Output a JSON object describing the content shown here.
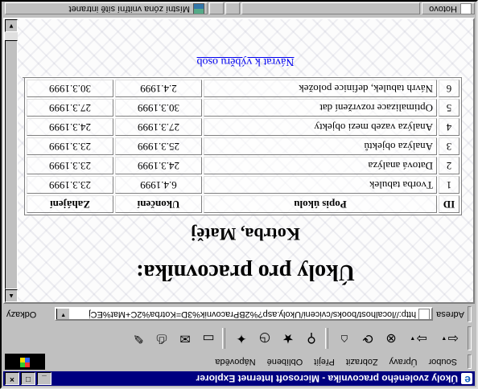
{
  "window": {
    "title": "Úkoly zvoleného pracovníka - Microsoft Internet Explorer",
    "buttons": {
      "minimize": "_",
      "maximize": "□",
      "close": "×"
    }
  },
  "menu": {
    "items": [
      "Soubor",
      "Úpravy",
      "Zobrazit",
      "Přejít",
      "Oblíbené",
      "Nápověda"
    ]
  },
  "toolbar": {
    "buttons": [
      {
        "name": "back-button",
        "icon": "arrow-left-icon",
        "glyph": "⇦"
      },
      {
        "name": "forward-button",
        "icon": "arrow-right-icon",
        "glyph": "⇨"
      },
      {
        "name": "stop-button",
        "icon": "stop-icon",
        "glyph": "⊗"
      },
      {
        "name": "refresh-button",
        "icon": "refresh-icon",
        "glyph": "⟳"
      },
      {
        "name": "home-button",
        "icon": "home-icon",
        "glyph": "⌂"
      },
      {
        "name": "search-button",
        "icon": "search-icon",
        "glyph": "⚲"
      },
      {
        "name": "favorites-button",
        "icon": "favorites-icon",
        "glyph": "★"
      },
      {
        "name": "history-button",
        "icon": "history-icon",
        "glyph": "◷"
      },
      {
        "name": "channels-button",
        "icon": "channels-icon",
        "glyph": "✦"
      },
      {
        "name": "fullscreen-button",
        "icon": "fullscreen-icon",
        "glyph": "▭"
      },
      {
        "name": "mail-button",
        "icon": "mail-icon",
        "glyph": "✉"
      },
      {
        "name": "print-button",
        "icon": "print-icon",
        "glyph": "⎙"
      },
      {
        "name": "edit-button",
        "icon": "edit-icon",
        "glyph": "✎"
      }
    ]
  },
  "address": {
    "label": "Adresa",
    "url": "http://localhost/books/cviceni/Ukoly.asp?%2BPracovnik%3D=Kotrba%2C+Mat%ECj",
    "links_label": "Odkazy"
  },
  "page": {
    "heading": "Úkoly pro pracovníka:",
    "worker": "Kotrba, Matěj",
    "columns": [
      "ID",
      "Popis úkolu",
      "Ukončení",
      "Zahájení"
    ],
    "rows": [
      {
        "id": "1",
        "description": "Tvorba tabulek",
        "end": "6.4.1999",
        "start": "23.3.1999"
      },
      {
        "id": "2",
        "description": "Datová analýza",
        "end": "24.3.1999",
        "start": "23.3.1999"
      },
      {
        "id": "3",
        "description": "Analýza objektů",
        "end": "25.3.1999",
        "start": "23.3.1999"
      },
      {
        "id": "4",
        "description": "Analýza vazeb mezi objekty",
        "end": "27.3.1999",
        "start": "24.3.1999"
      },
      {
        "id": "5",
        "description": "Optimalizace rozvržení dat",
        "end": "30.3.1999",
        "start": "27.3.1999"
      },
      {
        "id": "6",
        "description": "Návrh tabulek, definice položek",
        "end": "2.4.1999",
        "start": "30.3.1999"
      }
    ],
    "back_link": "Návrat k výběru osob"
  },
  "status": {
    "main": "Hotovo",
    "zone": "Místní zóna vnitřní sítě intranet"
  }
}
